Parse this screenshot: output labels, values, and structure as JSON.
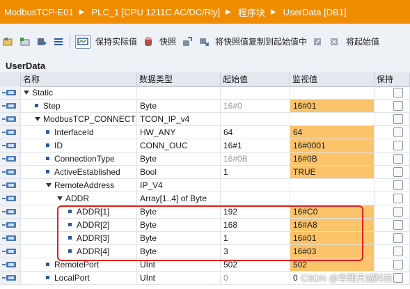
{
  "breadcrumb": {
    "items": [
      "ModbusTCP-E01",
      "PLC_1 [CPU 1211C AC/DC/Rly]",
      "程序块",
      "UserData [DB1]"
    ],
    "separator": "▶"
  },
  "toolbar": {
    "keep_actual_label": "保持实际值",
    "snapshot_label": "快照",
    "copy_snapshot_label": "将快照值复制到起始值中",
    "copy_start_label": "将起始值"
  },
  "block": {
    "title": "UserData"
  },
  "table": {
    "headers": {
      "name": "名称",
      "type": "数据类型",
      "start": "起始值",
      "monitor": "监视值",
      "keep": "保持"
    },
    "rows": [
      {
        "name": "Static",
        "type": "",
        "start": "",
        "monitor": ""
      },
      {
        "name": "Step",
        "type": "Byte",
        "start": "16#0",
        "monitor": "16#01"
      },
      {
        "name": "ModbusTCP_CONNECT",
        "type": "TCON_IP_v4",
        "start": "",
        "monitor": ""
      },
      {
        "name": "InterfaceId",
        "type": "HW_ANY",
        "start": "64",
        "monitor": "64"
      },
      {
        "name": "ID",
        "type": "CONN_OUC",
        "start": "16#1",
        "monitor": "16#0001"
      },
      {
        "name": "ConnectionType",
        "type": "Byte",
        "start": "16#0B",
        "monitor": "16#0B"
      },
      {
        "name": "ActiveEstablished",
        "type": "Bool",
        "start": "1",
        "monitor": "TRUE"
      },
      {
        "name": "RemoteAddress",
        "type": "IP_V4",
        "start": "",
        "monitor": ""
      },
      {
        "name": "ADDR",
        "type": "Array[1..4] of Byte",
        "start": "",
        "monitor": ""
      },
      {
        "name": "ADDR[1]",
        "type": "Byte",
        "start": "192",
        "monitor": "16#C0"
      },
      {
        "name": "ADDR[2]",
        "type": "Byte",
        "start": "168",
        "monitor": "16#A8"
      },
      {
        "name": "ADDR[3]",
        "type": "Byte",
        "start": "1",
        "monitor": "16#01"
      },
      {
        "name": "ADDR[4]",
        "type": "Byte",
        "start": "3",
        "monitor": "16#03"
      },
      {
        "name": "RemotePort",
        "type": "UInt",
        "start": "502",
        "monitor": "502"
      },
      {
        "name": "LocalPort",
        "type": "UInt",
        "start": "0",
        "monitor": "0"
      }
    ]
  },
  "watermark": "CSDN @华翔天诚科技",
  "colors": {
    "titlebar": "#f08c00",
    "monitor_cell": "#fbc36a",
    "highlight_box": "#e0231e"
  }
}
